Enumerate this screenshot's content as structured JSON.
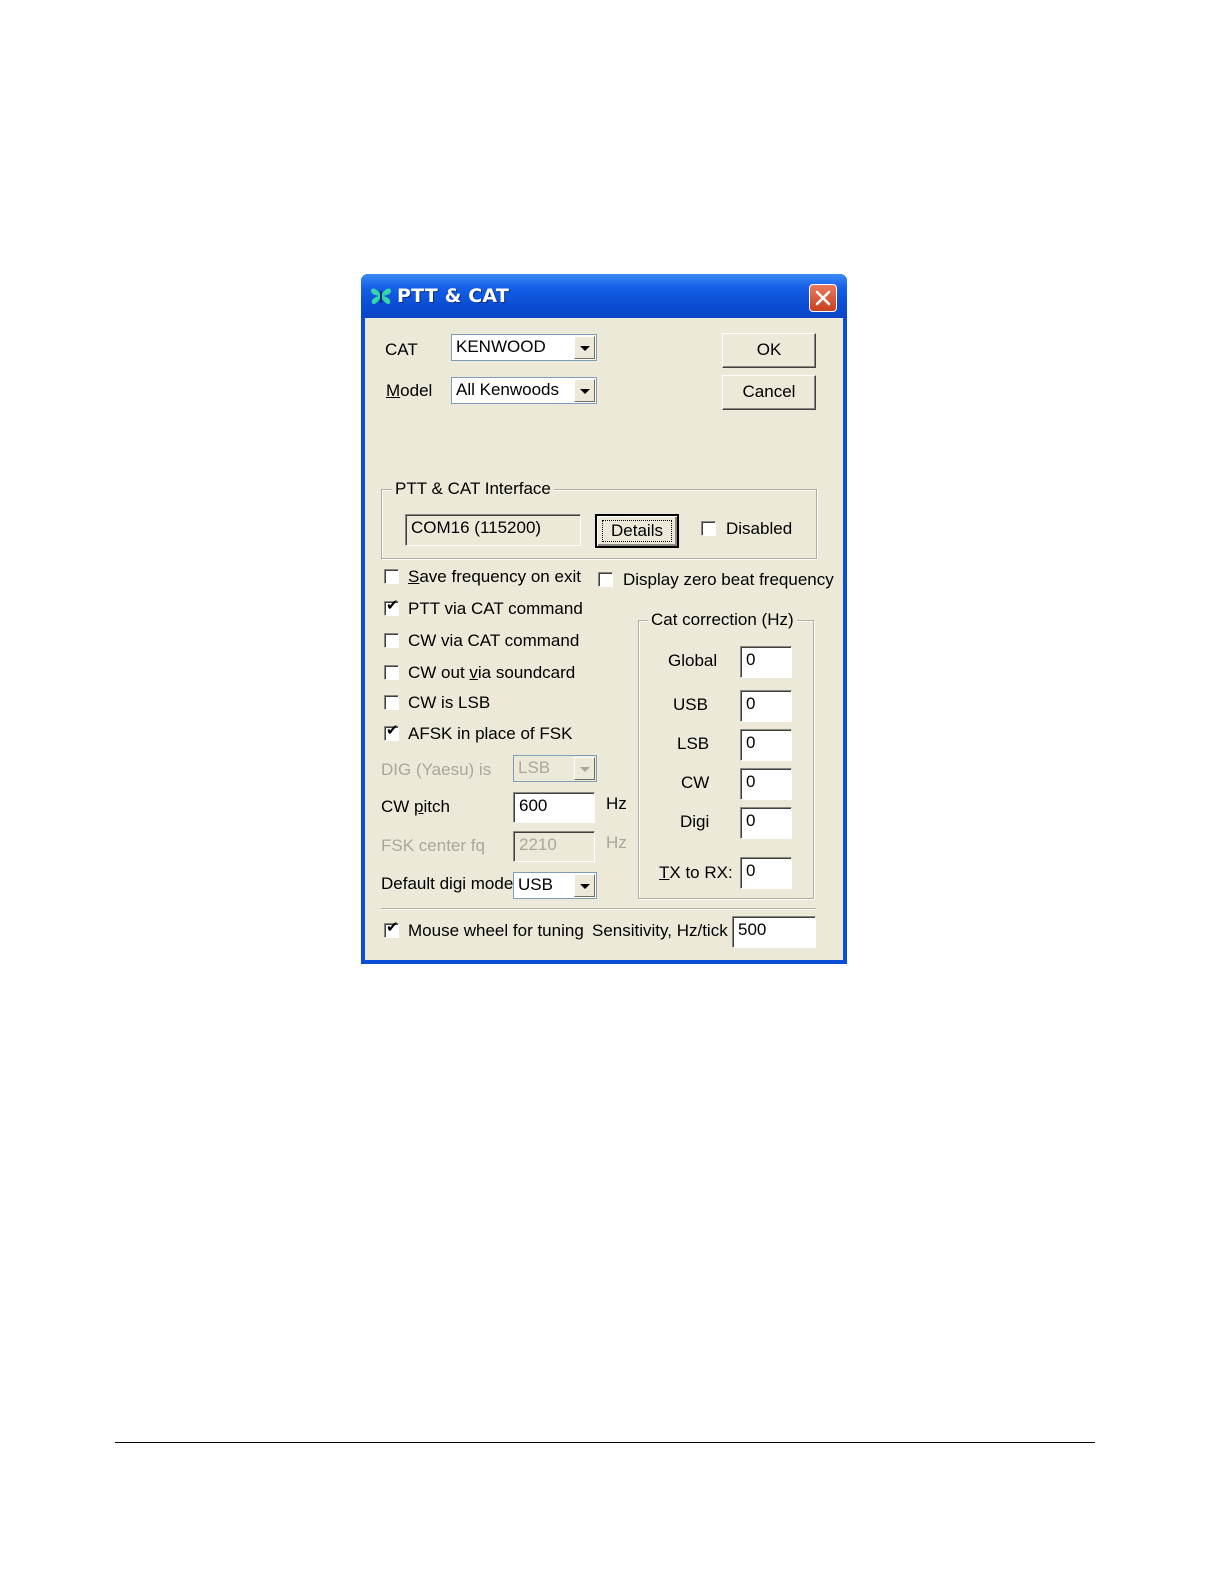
{
  "window": {
    "title": "PTT & CAT",
    "icon": "butterfly-app-icon",
    "close_icon": "close-icon"
  },
  "cat": {
    "label": "CAT",
    "value": "KENWOOD"
  },
  "model": {
    "label_first": "M",
    "label_rest": "odel",
    "value": "All Kenwoods"
  },
  "buttons": {
    "ok": "OK",
    "cancel": "Cancel",
    "details": "Details"
  },
  "interface": {
    "group_title": "PTT & CAT Interface",
    "port_value": "COM16 (115200)",
    "disabled_label": "Disabled",
    "disabled_checked": false
  },
  "options": {
    "save_freq": {
      "first": "S",
      "rest": "ave frequency on exit",
      "checked": false
    },
    "zero_beat": {
      "label": "Display zero beat frequency",
      "checked": false
    },
    "ptt_cat": {
      "label": "PTT via CAT command",
      "checked": true
    },
    "cw_cat": {
      "label": "CW via CAT command",
      "checked": false
    },
    "cw_soundcard": {
      "pre": "CW out ",
      "underlined": "v",
      "post": "ia soundcard",
      "checked": false
    },
    "cw_lsb": {
      "label": "CW is LSB",
      "checked": false
    },
    "afsk": {
      "label": "AFSK in place of FSK",
      "checked": true
    }
  },
  "dig_yaesu": {
    "label": "DIG (Yaesu) is",
    "value": "LSB"
  },
  "cw_pitch": {
    "pre": "CW ",
    "underlined": "p",
    "post": "itch",
    "value": "600",
    "unit": "Hz"
  },
  "fsk_center": {
    "label": "FSK center fq",
    "value": "2210",
    "unit": "Hz"
  },
  "default_digi": {
    "label": "Default digi mode",
    "value": "USB"
  },
  "cat_correction": {
    "group_title": "Cat correction (Hz)",
    "global": {
      "label": "Global",
      "value": "0"
    },
    "usb": {
      "label": "USB",
      "value": "0"
    },
    "lsb": {
      "label": "LSB",
      "value": "0"
    },
    "cw": {
      "label": "CW",
      "value": "0"
    },
    "digi": {
      "label": "Digi",
      "value": "0"
    },
    "tx_rx": {
      "first": "T",
      "rest": "X to RX:",
      "value": "0"
    }
  },
  "mouse_wheel": {
    "label": "Mouse wheel for tuning",
    "checked": true
  },
  "sensitivity": {
    "label": "Sensitivity, Hz/tick",
    "value": "500"
  },
  "check_mark": "✔"
}
